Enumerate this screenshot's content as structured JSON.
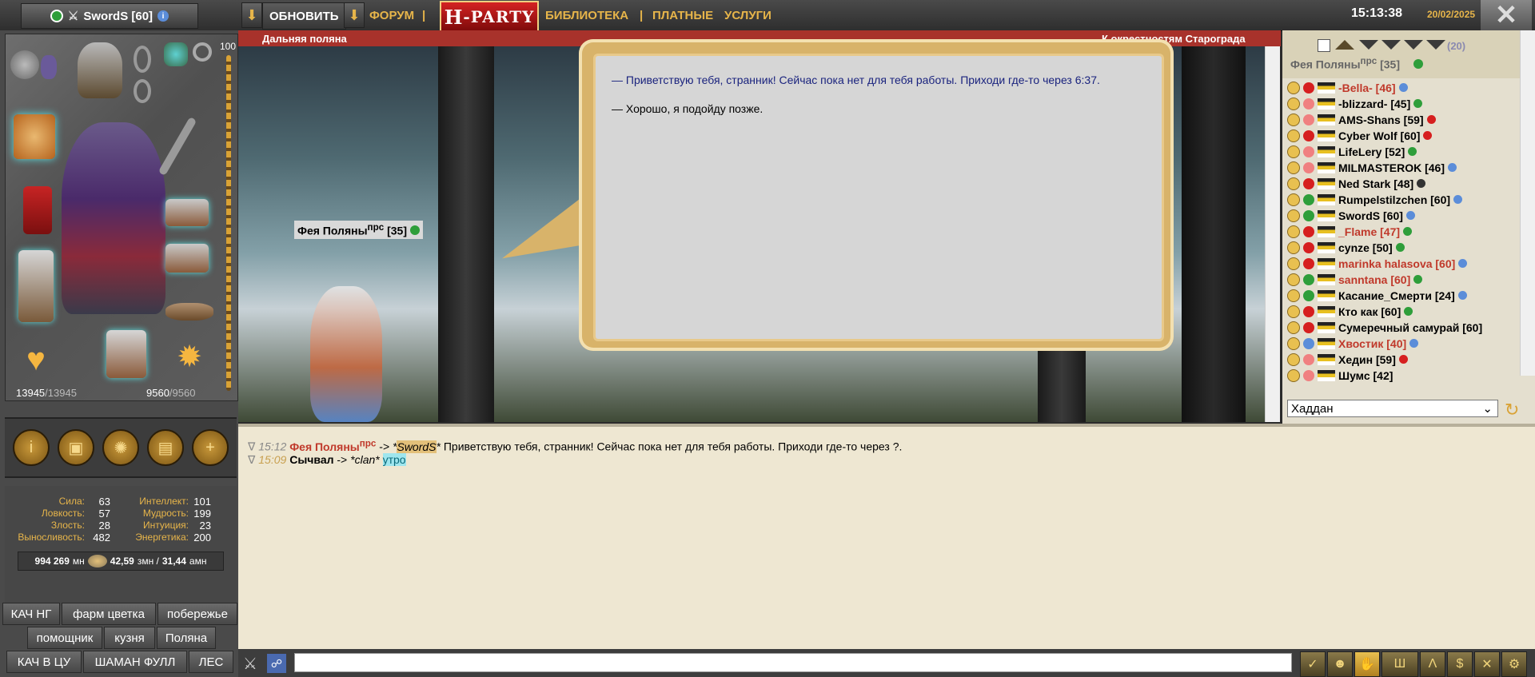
{
  "topbar": {
    "player_name": "SwordS [60]",
    "refresh_label": "ОБНОВИТЬ",
    "forum_label": "ФОРУМ",
    "sep": "|",
    "logo_text": "-PARTY",
    "library_label": "БИБЛИОТЕКА",
    "paid_label": "ПЛАТНЫЕ",
    "services_label": "УСЛУГИ",
    "time": "15:13:38",
    "date": "20/02/2025",
    "close_label": "✕"
  },
  "equipment": {
    "level_tag": "100",
    "hp_current": "13945",
    "hp_max": "/13945",
    "mana_current": "9560",
    "mana_max": "/9560"
  },
  "stats": [
    {
      "label": "Сила:",
      "value": "63"
    },
    {
      "label": "Ловкость:",
      "value": "57"
    },
    {
      "label": "Злость:",
      "value": "28"
    },
    {
      "label": "Выносливость:",
      "value": "482"
    }
  ],
  "stats_right": [
    {
      "label": "Интеллект:",
      "value": "101"
    },
    {
      "label": "Мудрость:",
      "value": "199"
    },
    {
      "label": "Интуиция:",
      "value": "23"
    },
    {
      "label": "Энергетика:",
      "value": "200"
    }
  ],
  "money": {
    "mn": "994 269",
    "mn_unit": "мн",
    "zmn": "42,59",
    "zmn_unit": "змн /",
    "amn": "31,44",
    "amn_unit": "амн"
  },
  "quick_buttons": [
    "КАЧ НГ",
    "фарм цветка",
    "побережье",
    "помощник",
    "кузня",
    "Поляна",
    "КАЧ В ЦУ",
    "ШАМАН ФУЛЛ",
    "ЛЕС"
  ],
  "location": {
    "name": "Дальняя поляна",
    "exit_text": "К окрестностям Старограда"
  },
  "dialog": {
    "npc_line": "— Приветствую тебя, странник! Сейчас пока нет для тебя работы. Приходи где-то через 6:37.",
    "reply_option": "— Хорошо, я подойду позже."
  },
  "npc": {
    "name": "Фея Поляны",
    "sup": "прс",
    "level": "[35]"
  },
  "online": {
    "count": "(20)",
    "location_title": "Фея Поляны",
    "location_sup": "прс",
    "location_level": "[35]",
    "players": [
      {
        "name": "-Bella- [46]",
        "color": "#c0392b",
        "status": "#5b8dd9"
      },
      {
        "name": "-blizzard- [45]",
        "color": "#000000",
        "status": "#2e9e3a"
      },
      {
        "name": "AMS-Shans [59]",
        "color": "#000000",
        "status": "#d61f1f"
      },
      {
        "name": "Cyber Wolf [60]",
        "color": "#000000",
        "status": "#d61f1f"
      },
      {
        "name": "LifeLery [52]",
        "color": "#000000",
        "status": "#2e9e3a"
      },
      {
        "name": "MILMASTEROK [46]",
        "color": "#000000",
        "status": "#5b8dd9"
      },
      {
        "name": "Ned Stark [48]",
        "color": "#000000",
        "status": "#333333"
      },
      {
        "name": "Rumpelstilzchen [60]",
        "color": "#000000",
        "status": "#5b8dd9"
      },
      {
        "name": "SwordS [60]",
        "color": "#000000",
        "status": "#5b8dd9"
      },
      {
        "name": "_Flame [47]",
        "color": "#c0392b",
        "status": "#2e9e3a"
      },
      {
        "name": "cynze [50]",
        "color": "#000000",
        "status": "#2e9e3a"
      },
      {
        "name": "marinka halasova [60]",
        "color": "#c0392b",
        "status": "#5b8dd9"
      },
      {
        "name": "sanntana [60]",
        "color": "#c0392b",
        "status": "#2e9e3a"
      },
      {
        "name": "Касание_Смерти [24]",
        "color": "#000000",
        "status": "#5b8dd9"
      },
      {
        "name": "Кто как [60]",
        "color": "#000000",
        "status": "#2e9e3a"
      },
      {
        "name": "Сумеречный самурай [60]",
        "color": "#000000",
        "status": ""
      },
      {
        "name": "Хвостик [40]",
        "color": "#c0392b",
        "status": "#5b8dd9"
      },
      {
        "name": "Хедин [59]",
        "color": "#000000",
        "status": "#d61f1f"
      },
      {
        "name": "Шумс [42]",
        "color": "#000000",
        "status": ""
      }
    ],
    "room_select": "Хаддан"
  },
  "chat": [
    {
      "time": "15:12",
      "sender": "Фея Поляны",
      "sender_sup": "прс",
      "arrow": "->",
      "target": "SwordS",
      "text": "Приветствую тебя, странник! Сейчас пока нет для тебя работы. Приходи где-то через ?."
    },
    {
      "time": "15:09",
      "sender": "Сычвал",
      "sender_sup": "",
      "arrow": "->",
      "target": "clan",
      "text": "утро"
    }
  ],
  "colors": {
    "accent": "#e7b54a",
    "location_bar": "#a8322b",
    "chat_bg": "#eee7d2"
  }
}
